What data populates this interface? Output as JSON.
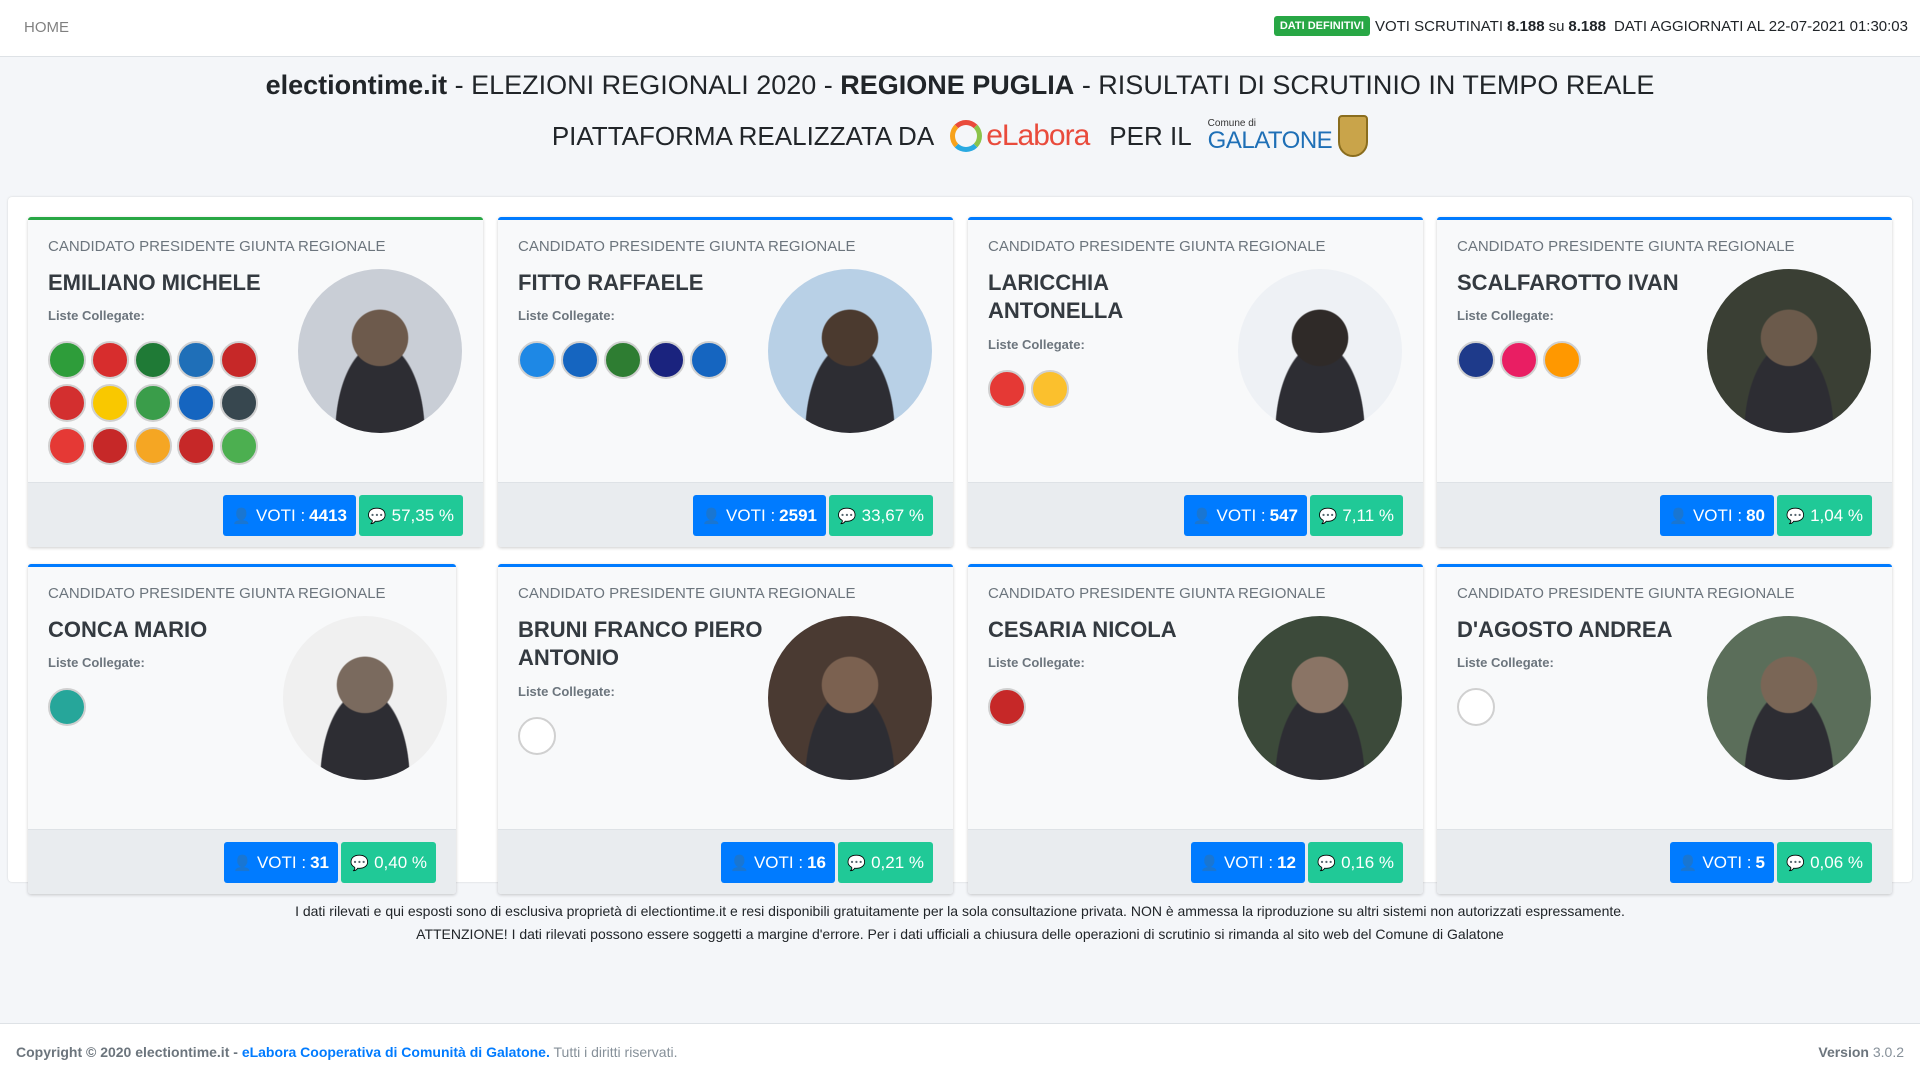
{
  "nav": {
    "home": "HOME",
    "badge": "DATI DEFINITIVI",
    "voti_scrutinati_label": "VOTI SCRUTINATI",
    "voti_scrutinati": "8.188",
    "su": "su",
    "voti_totali": "8.188",
    "aggiornati": "DATI AGGIORNATI AL 22-07-2021 01:30:03"
  },
  "header": {
    "site": "electiontime.it",
    "sep1": " - ELEZIONI REGIONALI 2020 - ",
    "region": "REGIONE PUGLIA",
    "sep2": " - RISULTATI DI SCRUTINIO IN TEMPO REALE",
    "platform": "PIATTAFORMA REALIZZATA DA",
    "elabora_logo": "eLabora",
    "per_il": "PER IL",
    "galatone_small": "Comune di",
    "galatone_big": "GALATONE"
  },
  "card_role": "CANDIDATO PRESIDENTE GIUNTA REGIONALE",
  "lists_label": "Liste Collegate:",
  "votes_label": "VOTI :",
  "candidates": [
    {
      "name": "EMILIANO MICHELE",
      "votes": "4413",
      "perc": "57,35 %",
      "lists": [
        "#2e9d3a",
        "#d72d2d",
        "#1f7a36",
        "#1f6fb8",
        "#c62828",
        "#d32f2f",
        "#f9c800",
        "#3a9d4a",
        "#1565c0",
        "#37474f",
        "#e53935",
        "#c62828",
        "#f5a623",
        "#c62828",
        "#4caf50"
      ]
    },
    {
      "name": "FITTO RAFFAELE",
      "votes": "2591",
      "perc": "33,67 %",
      "lists": [
        "#1e88e5",
        "#1565c0",
        "#2e7d32",
        "#1a237e",
        "#1565c0"
      ]
    },
    {
      "name": "LARICCHIA ANTONELLA",
      "votes": "547",
      "perc": "7,11 %",
      "lists": [
        "#e53935",
        "#fbc02d"
      ]
    },
    {
      "name": "SCALFAROTTO IVAN",
      "votes": "80",
      "perc": "1,04 %",
      "lists": [
        "#1e3a8a",
        "#e91e63",
        "#ff9800"
      ]
    },
    {
      "name": "CONCA MARIO",
      "votes": "31",
      "perc": "0,40 %",
      "lists": [
        "#26a69a"
      ]
    },
    {
      "name": "BRUNI FRANCO PIERO ANTONIO",
      "votes": "16",
      "perc": "0,21 %",
      "lists": [
        "#ffffff"
      ]
    },
    {
      "name": "CESARIA NICOLA",
      "votes": "12",
      "perc": "0,16 %",
      "lists": [
        "#c62828"
      ]
    },
    {
      "name": "D'AGOSTO ANDREA",
      "votes": "5",
      "perc": "0,06 %",
      "lists": [
        "#ffffff"
      ]
    }
  ],
  "notice": {
    "line1": "I dati rilevati e qui esposti sono di esclusiva proprietà di electiontime.it e resi disponibili gratuitamente per la sola consultazione privata. NON è ammessa la riproduzione su altri sistemi non autorizzati espressamente.",
    "line2": "ATTENZIONE! I dati rilevati possono essere soggetti a margine d'errore. Per i dati ufficiali a chiusura delle operazioni di scrutinio si rimanda al sito web del Comune di Galatone"
  },
  "footer": {
    "copyright": "Copyright © 2020 electiontime.it -",
    "company": "eLabora Cooperativa di Comunità di Galatone.",
    "rights": "Tutti i diritti riservati.",
    "version_label": "Version",
    "version": "3.0.2"
  },
  "colors": {
    "primary": "#007bff",
    "success": "#28a745",
    "teal": "#20c997"
  }
}
